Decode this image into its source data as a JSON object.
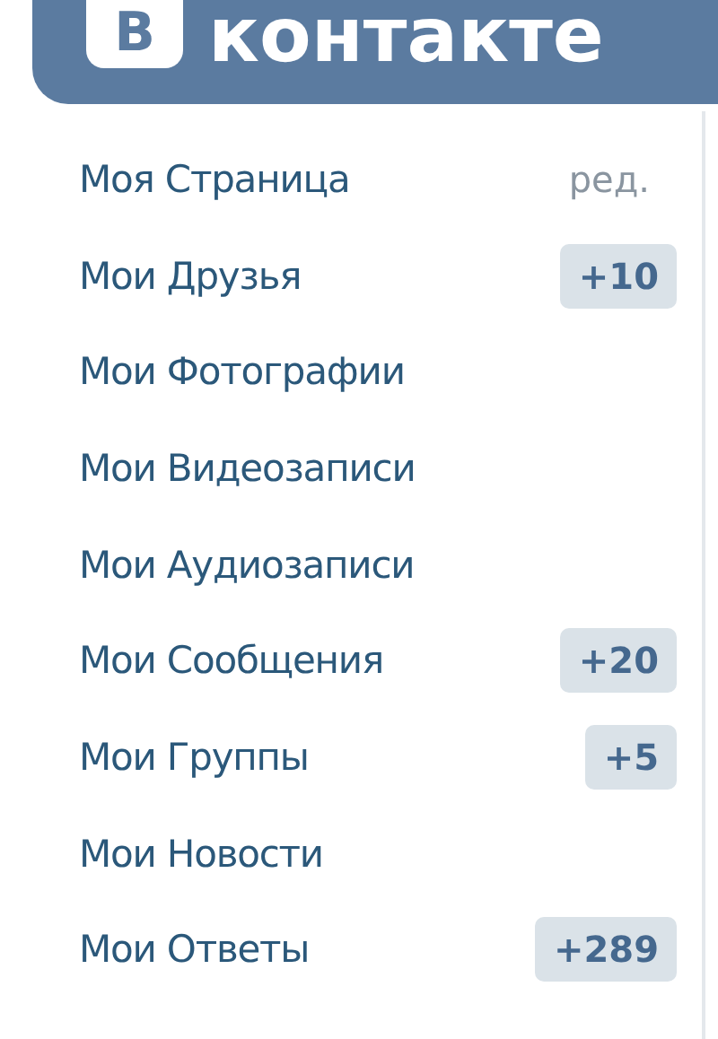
{
  "header": {
    "logo_letter": "В",
    "logo_text": "контакте"
  },
  "menu": [
    {
      "label": "Моя Страница",
      "action": "ред."
    },
    {
      "label": "Мои Друзья",
      "badge": "+10"
    },
    {
      "label": "Мои Фотографии"
    },
    {
      "label": "Мои Видеозаписи"
    },
    {
      "label": "Мои Аудиозаписи"
    },
    {
      "label": "Мои Сообщения",
      "badge": "+20"
    },
    {
      "label": "Мои Группы",
      "badge": "+5"
    },
    {
      "label": "Мои Новости"
    },
    {
      "label": "Мои Ответы",
      "badge": "+289"
    }
  ]
}
